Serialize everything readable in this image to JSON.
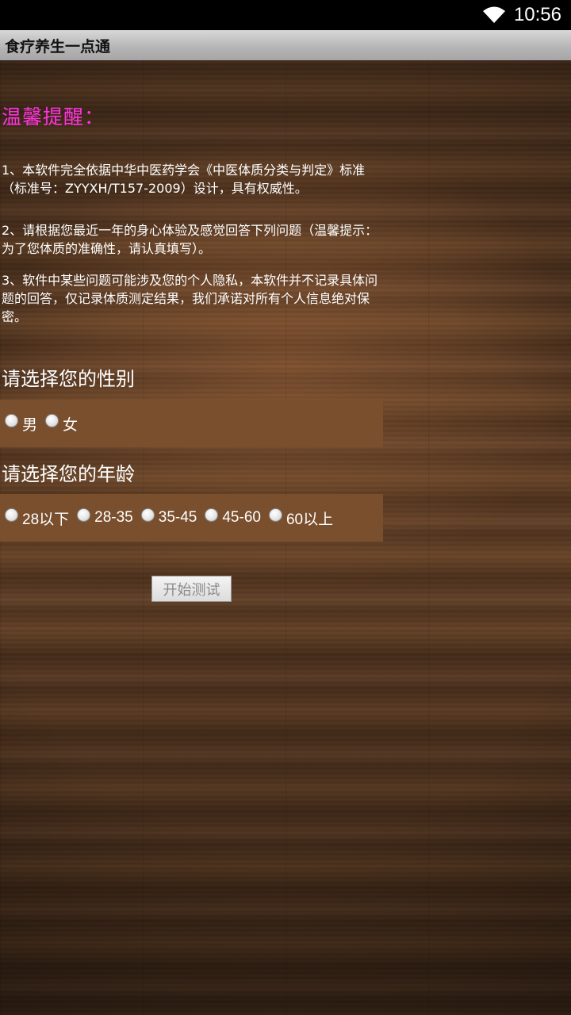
{
  "status_bar": {
    "time": "10:56",
    "wifi_icon": "wifi-icon"
  },
  "app": {
    "title": "食疗养生一点通"
  },
  "reminder": {
    "title": "温馨提醒：",
    "items": [
      "1、本软件完全依据中华中医药学会《中医体质分类与判定》标准（标准号：ZYYXH/T157-2009）设计，具有权威性。",
      "2、请根据您最近一年的身心体验及感觉回答下列问题（温馨提示：为了您体质的准确性，请认真填写）。",
      "3、软件中某些问题可能涉及您的个人隐私，本软件并不记录具体问题的回答，仅记录体质测定结果，我们承诺对所有个人信息绝对保密。"
    ]
  },
  "gender": {
    "title": "请选择您的性别",
    "options": [
      "男",
      "女"
    ]
  },
  "age": {
    "title": "请选择您的年龄",
    "options": [
      "28以下",
      "28-35",
      "35-45",
      "45-60",
      "60以上"
    ]
  },
  "start_button": {
    "label": "开始测试"
  },
  "colors": {
    "reminder_title": "#ff33dd",
    "option_bar": "#7a4f2d",
    "title_bar": "#b4b4b4"
  }
}
